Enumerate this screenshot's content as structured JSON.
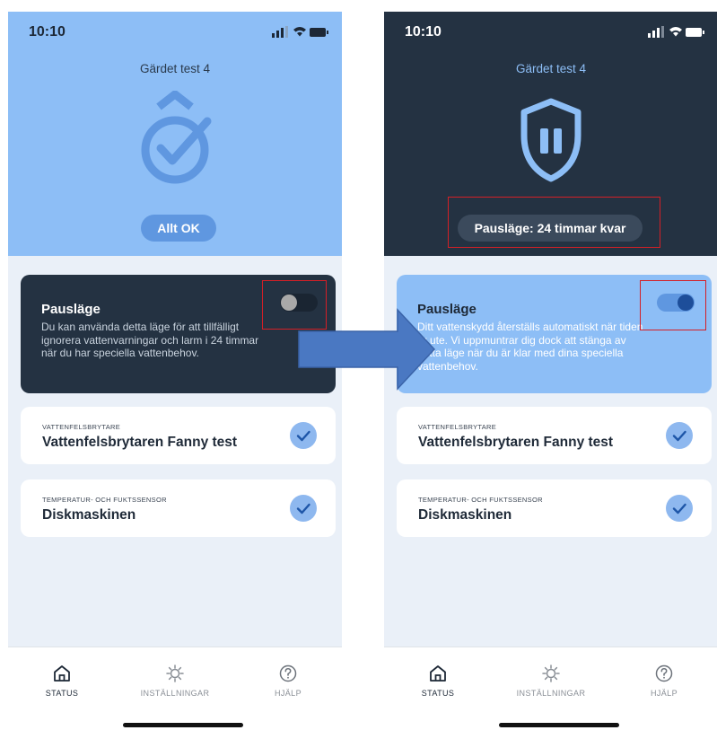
{
  "colors": {
    "header_ok": "#8dbef6",
    "header_pause": "#243242",
    "pause_card_dark": "#243242",
    "pause_card_light": "#8dbef6",
    "toggle_active": "#1d4e9a",
    "highlight_red": "#d41f26",
    "arrow_blue": "#4a78c2"
  },
  "screens": [
    {
      "status_time": "10:10",
      "place": "Gärdet test 4",
      "hero_icon": "shield-check-icon",
      "status_pill": "Allt OK",
      "pause": {
        "title": "Pausläge",
        "description": "Du kan använda detta läge för att tillfälligt ignorera vattenvarningar och larm i 24 timmar när du har speciella vattenbehov.",
        "toggle_on": false
      },
      "devices": [
        {
          "category": "VATTENFELSBRYTARE",
          "name": "Vattenfelsbrytaren Fanny test",
          "ok": true
        },
        {
          "category": "TEMPERATUR- OCH FUKTSSENSOR",
          "name": "Diskmaskinen",
          "ok": true
        }
      ]
    },
    {
      "status_time": "10:10",
      "place": "Gärdet test 4",
      "hero_icon": "shield-pause-icon",
      "status_pill": "Pausläge: 24 timmar kvar",
      "pause": {
        "title": "Pausläge",
        "description": "Ditt vattenskydd återställs automatiskt när tiden är ute. Vi uppmuntrar dig dock att stänga av detta läge när du är klar med dina speciella vattenbehov.",
        "toggle_on": true
      },
      "devices": [
        {
          "category": "VATTENFELSBRYTARE",
          "name": "Vattenfelsbrytaren Fanny test",
          "ok": true
        },
        {
          "category": "TEMPERATUR- OCH FUKTSSENSOR",
          "name": "Diskmaskinen",
          "ok": true
        }
      ]
    }
  ],
  "tabbar": {
    "tabs": [
      {
        "label": "STATUS",
        "icon": "home-icon",
        "active": true
      },
      {
        "label": "INSTÄLLNINGAR",
        "icon": "gear-icon",
        "active": false
      },
      {
        "label": "HJÄLP",
        "icon": "help-icon",
        "active": false
      }
    ]
  }
}
